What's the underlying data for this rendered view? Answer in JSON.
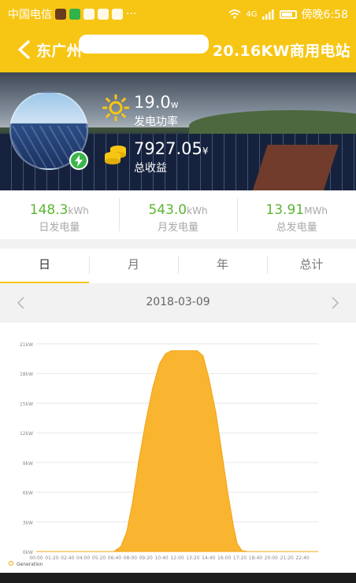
{
  "status_bar": {
    "carrier": "中国电信",
    "dots": "···",
    "network": "4G",
    "time": "傍晚6:58"
  },
  "header": {
    "back_icon": "back-arrow-icon",
    "title": "东广州",
    "title_tail": "20.16KW商用电站"
  },
  "hero": {
    "power_value": "19.0",
    "power_unit": "w",
    "power_label": "发电功率",
    "income_value": "7927.05",
    "income_unit": "¥",
    "income_label": "总收益"
  },
  "stats": [
    {
      "value": "148.3",
      "unit": "kWh",
      "label": "日发电量"
    },
    {
      "value": "543.0",
      "unit": "kWh",
      "label": "月发电量"
    },
    {
      "value": "13.91",
      "unit": "MWh",
      "label": "总发电量"
    }
  ],
  "tabs": [
    {
      "label": "日"
    },
    {
      "label": "月"
    },
    {
      "label": "年"
    },
    {
      "label": "总计"
    }
  ],
  "date_nav": {
    "date": "2018-03-09"
  },
  "colors": {
    "accent": "#f7c614",
    "green": "#5cb531",
    "series": "#f9b430"
  },
  "chart_data": {
    "type": "area",
    "y_ticks": [
      "0kW",
      "3kW",
      "6kW",
      "9kW",
      "12kW",
      "15kW",
      "18kW",
      "21kW"
    ],
    "ylim": [
      0,
      21
    ],
    "x_ticks": [
      "00:00",
      "01:20",
      "02:40",
      "04:00",
      "05:20",
      "06:40",
      "08:00",
      "09:20",
      "10:40",
      "12:00",
      "13:20",
      "14:40",
      "16:00",
      "17:20",
      "18:40",
      "20:00",
      "21:20",
      "22:40"
    ],
    "series": [
      {
        "name": "Generation",
        "x_hours": [
          0,
          6.6,
          7.2,
          7.7,
          8.2,
          8.7,
          9.3,
          9.9,
          10.5,
          11.0,
          11.5,
          11.8,
          12.3,
          13.0,
          13.7,
          14.2,
          14.7,
          15.3,
          15.8,
          16.3,
          16.8,
          17.1,
          17.5,
          18.0,
          24.0
        ],
        "values": [
          0,
          0,
          0.5,
          2,
          5,
          9,
          13,
          16.5,
          19,
          20,
          20.3,
          20.3,
          20.3,
          20.3,
          20.3,
          19.8,
          17.5,
          14,
          10,
          6,
          2.5,
          0.8,
          0.1,
          0,
          0
        ]
      }
    ]
  }
}
